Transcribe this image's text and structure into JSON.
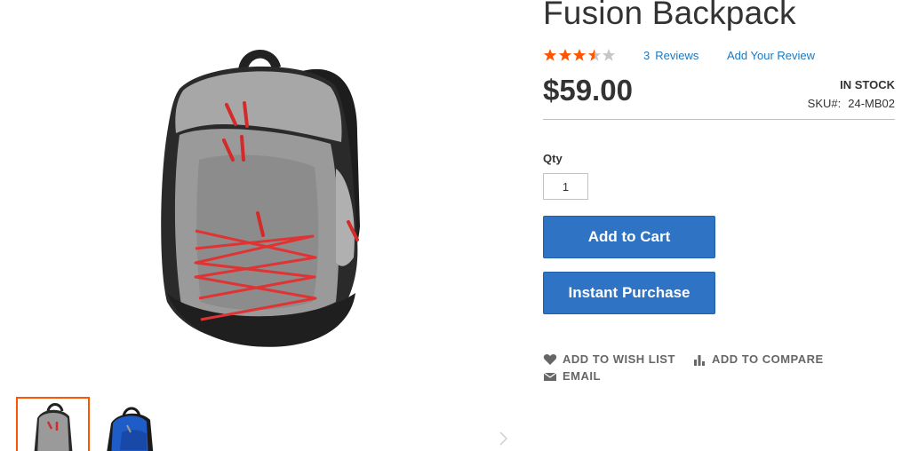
{
  "product": {
    "title": "Fusion Backpack",
    "rating": 3,
    "rating_max": 5,
    "reviews_count": "3",
    "reviews_label": "Reviews",
    "add_review_label": "Add Your Review",
    "price": "$59.00",
    "stock_status": "IN STOCK",
    "sku_label": "SKU#:",
    "sku_value": "24-MB02"
  },
  "form": {
    "qty_label": "Qty",
    "qty_value": "1",
    "add_to_cart_label": "Add to Cart",
    "instant_purchase_label": "Instant Purchase"
  },
  "actions": {
    "wish_list_label": "ADD TO WISH LIST",
    "compare_label": "ADD TO COMPARE",
    "email_label": "EMAIL"
  },
  "gallery": {
    "thumbnails": [
      {
        "name": "gray-backpack-thumbnail",
        "active": true
      },
      {
        "name": "blue-backpack-thumbnail",
        "active": false
      }
    ]
  },
  "icons": {
    "star": "star-icon",
    "wish": "heart-icon",
    "compare": "bar-chart-icon",
    "email": "envelope-icon",
    "next": "chevron-right-icon"
  },
  "colors": {
    "accent": "#ff5501",
    "button": "#2f73c4",
    "link": "#1979c3",
    "star_on": "#ff5501",
    "star_off": "#c7c7c7"
  }
}
